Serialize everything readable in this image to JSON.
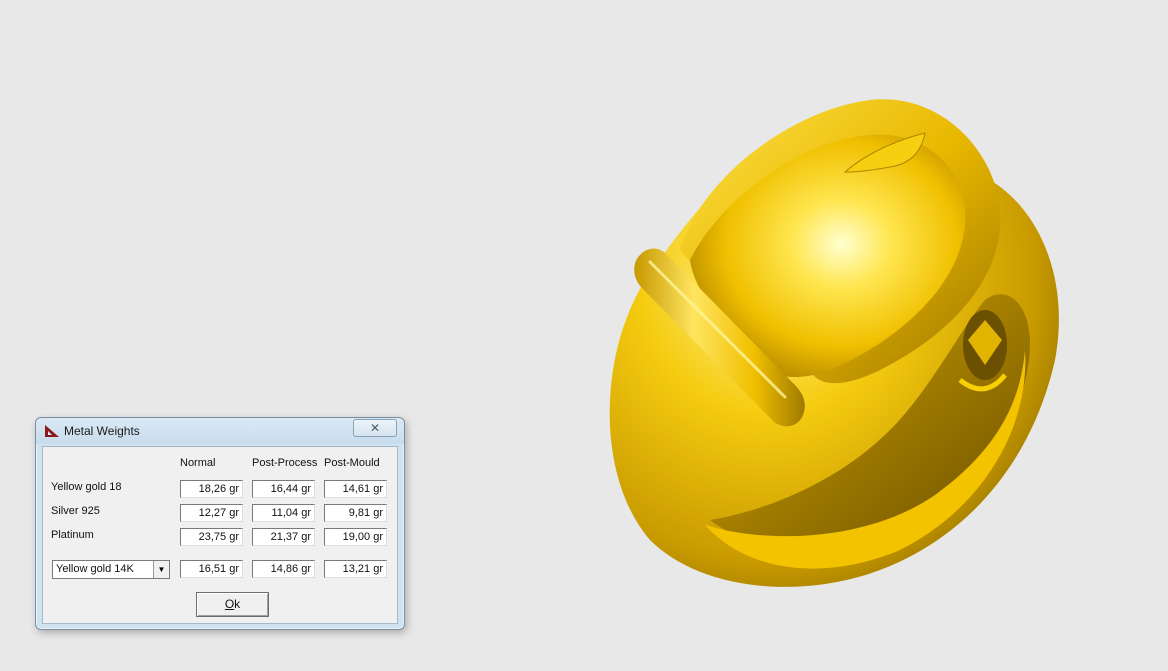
{
  "dialog": {
    "title": "Metal Weights",
    "close_glyph": "✕",
    "columns": [
      "Normal",
      "Post-Process",
      "Post-Mould"
    ],
    "rows": [
      {
        "label": "Yellow gold 18",
        "values": [
          "18,26 gr",
          "16,44 gr",
          "14,61 gr"
        ]
      },
      {
        "label": "Silver 925",
        "values": [
          "12,27 gr",
          "11,04 gr",
          "9,81 gr"
        ]
      },
      {
        "label": "Platinum",
        "values": [
          "23,75 gr",
          "21,37 gr",
          "19,00 gr"
        ]
      }
    ],
    "custom_row": {
      "selected_metal": "Yellow gold 14K",
      "values": [
        "16,51 gr",
        "14,86 gr",
        "13,21 gr"
      ]
    },
    "ok_mnemonic": "O",
    "ok_rest": "k"
  },
  "colors": {
    "background": "#e8e8e8",
    "metal_highlight": "#fff27a",
    "metal_mid": "#f2c400",
    "metal_shadow": "#a07a00",
    "metal_dark": "#5a4200",
    "titlebar": "#cfe2f0"
  },
  "icons": {
    "app": "ruler-triangle-icon",
    "close": "close-icon",
    "dropdown": "chevron-down-icon"
  }
}
